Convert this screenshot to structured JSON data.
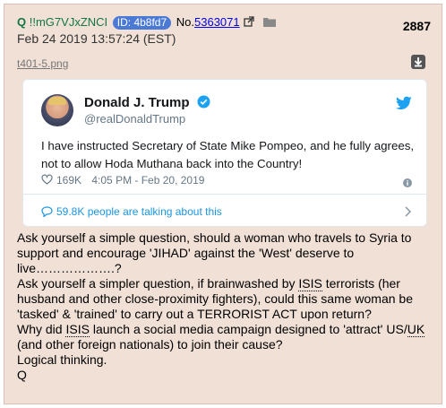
{
  "post": {
    "name": "Q",
    "tripcode": "!!mG7VJxZNCI",
    "id_label": "ID: 4b8fd7",
    "postno_prefix": "No.",
    "postno": "5363071",
    "date": "Feb 24 2019 13:57:24 (EST)",
    "count": "2887",
    "filename": "t401-5.png",
    "background_color": "#f0e0d6",
    "name_color": "#117743",
    "id_color": "#4a7ad6"
  },
  "tweet": {
    "name": "Donald J. Trump",
    "handle": "@realDonaldTrump",
    "text": "I have instructed Secretary of State Mike Pompeo, and he fully agrees, not to allow Hoda Muthana back into the Country!",
    "likes": "169K",
    "time": "4:05 PM - Feb 20, 2019",
    "talking": "59.8K people are talking about this",
    "accent_color": "#1da1f2"
  },
  "message": {
    "line1": "Ask yourself a simple question, should a woman who travels to Syria to support and encourage 'JIHAD' against the 'West' deserve to live……………….?",
    "line2_a": "Ask yourself a simpler question, if brainwashed by ",
    "isis": "ISIS",
    "line2_b": " terrorists (her husband and other close-proximity fighters), could this same woman be 'tasked' & 'trained' to carry out a TERRORIST ACT upon return?",
    "line3_a": "Why did ",
    "line3_b": " launch a social media campaign designed to 'attract' US/",
    "uk": "UK",
    "line3_c": " (and other foreign nationals) to join their cause?",
    "line4": "Logical thinking.",
    "line5": "Q"
  },
  "icons": {
    "external_link": "external-link-icon",
    "folder": "folder-icon",
    "download": "download-icon",
    "verified": "verified-badge-icon",
    "bird": "twitter-bird-icon",
    "heart": "heart-icon",
    "info": "info-icon",
    "bubble": "speech-bubble-icon",
    "chevron": "chevron-right-icon"
  }
}
